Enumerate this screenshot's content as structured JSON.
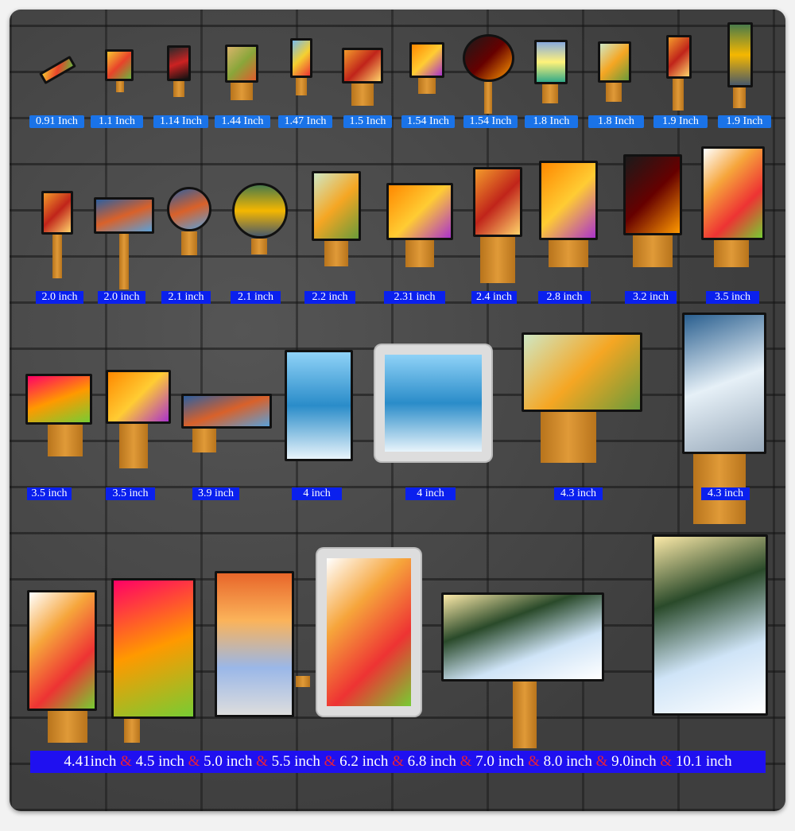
{
  "row1_labels": [
    "0.91 Inch",
    "1.1 Inch",
    "1.14 Inch",
    "1.44 Inch",
    "1.47 Inch",
    "1.5 Inch",
    "1.54 Inch",
    "1.54 Inch",
    "1.8 Inch",
    "1.8 Inch",
    "1.9 Inch",
    "1.9 Inch"
  ],
  "row2_labels": [
    "2.0 inch",
    "2.0 inch",
    "2.1 inch",
    "2.1 inch",
    "2.2 inch",
    "2.31 inch",
    "2.4 inch",
    "2.8 inch",
    "3.2 inch",
    "3.5 inch"
  ],
  "row3_labels": [
    "3.5 inch",
    "3.5 inch",
    "3.9 inch",
    "4 inch",
    "4 inch",
    "4.3 inch",
    "4.3 inch"
  ],
  "banner": {
    "sizes": [
      "4.41inch",
      "4.5 inch",
      "5.0 inch",
      "5.5 inch",
      "6.2 inch",
      "6.8 inch",
      "7.0  inch",
      "8.0 inch",
      "9.0inch",
      "10.1 inch"
    ],
    "separator": "&"
  },
  "colors": {
    "row1_label_bg": "#1a73e8",
    "row_label_bg": "#0a20ee",
    "banner_bg": "#1f10f0",
    "separator": "#e8203a",
    "wall": "#454545"
  }
}
